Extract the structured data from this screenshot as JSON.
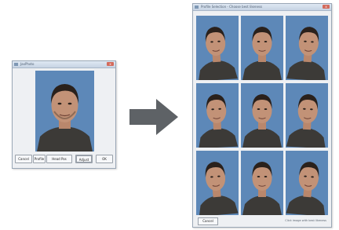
{
  "editor": {
    "title": "JaxPhoto",
    "close_glyph": "x",
    "buttons": [
      "Cancel",
      "Profile",
      "Head Pos",
      "Adjust",
      "OK"
    ]
  },
  "arrow": {
    "icon": "right-arrow-icon",
    "color": "#5e6266"
  },
  "results": {
    "title": "Profile Selection - Choose best likeness",
    "close_glyph": "x",
    "cancel_label": "Cancel",
    "hint": "Click image with best likeness",
    "rows": 3,
    "cols": 3
  },
  "colors": {
    "photo_bg": "#5d88b8",
    "skin": "#c29277",
    "hair": "#2a211c",
    "shirt": "#3c3a37"
  }
}
